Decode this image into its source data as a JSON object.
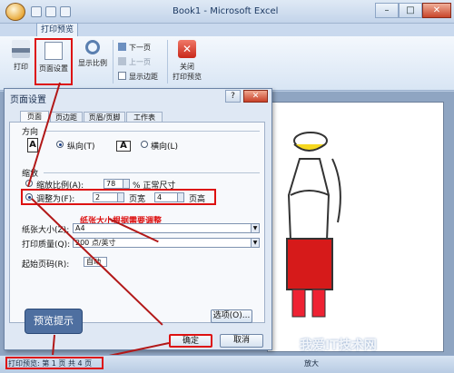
{
  "window": {
    "title": "Book1 - Microsoft Excel",
    "minimize": "–",
    "maximize": "□",
    "close": "✕"
  },
  "ribbon": {
    "tab": "打印预览",
    "print_label": "打印",
    "page_setup_label": "页面设置",
    "zoom_label": "显示比例",
    "next_page": "下一页",
    "prev_page": "上一页",
    "show_margins": "显示边距",
    "close_line1": "关闭",
    "close_line2": "打印预览"
  },
  "dialog": {
    "title": "页面设置",
    "help": "?",
    "close": "✕",
    "tabs": [
      "页面",
      "页边距",
      "页眉/页脚",
      "工作表"
    ],
    "orientation": {
      "heading": "方向",
      "portrait": "纵向(T)",
      "landscape": "横向(L)",
      "selected": "portrait"
    },
    "scaling": {
      "heading": "缩放",
      "adjust_to": "缩放比例(A):",
      "adjust_value": "78",
      "adjust_suffix": "% 正常尺寸",
      "fit_to": "调整为(F):",
      "pages_wide": "2",
      "pages_wide_label": "页宽",
      "pages_tall": "4",
      "pages_tall_label": "页高",
      "selected": "fit_to"
    },
    "paper_size": {
      "label": "纸张大小(Z):",
      "value": "A4"
    },
    "print_quality": {
      "label": "打印质量(Q):",
      "value": "200 点/英寸"
    },
    "first_page": {
      "label": "起始页码(R):",
      "value": "自动"
    },
    "options_button": "选项(O)...",
    "ok_button": "确定",
    "cancel_button": "取消"
  },
  "annotation": {
    "note": "纸张大小根据需要调整",
    "callout": "预览提示"
  },
  "status": {
    "text": "打印预览: 第 1 页 共 4 页",
    "zoom_in": "放大"
  },
  "watermark": "我爱IT技术网",
  "colors": {
    "highlight": "#dd1111",
    "arrow": "#b21818"
  }
}
